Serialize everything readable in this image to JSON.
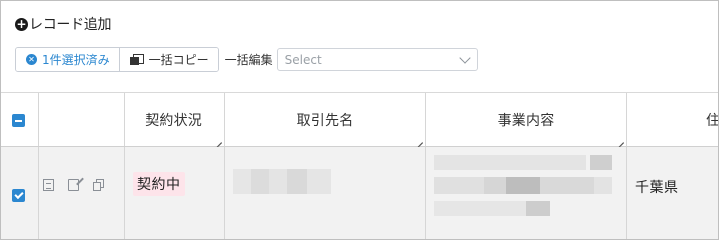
{
  "toolbar": {
    "add_record": "レコード追加",
    "selected_label": "1件選択済み",
    "bulk_copy": "一括コピー",
    "bulk_edit_label": "一括編集",
    "bulk_edit_placeholder": "Select"
  },
  "table": {
    "columns": [
      "契約状況",
      "取引先名",
      "事業内容",
      "住"
    ],
    "rows": [
      {
        "selected": true,
        "contract_status": "契約中",
        "prefecture": "千葉県"
      }
    ]
  },
  "colors": {
    "accent": "#2b87d0",
    "badge_bg": "#fde4ea",
    "row_bg": "#f2f2f2"
  }
}
